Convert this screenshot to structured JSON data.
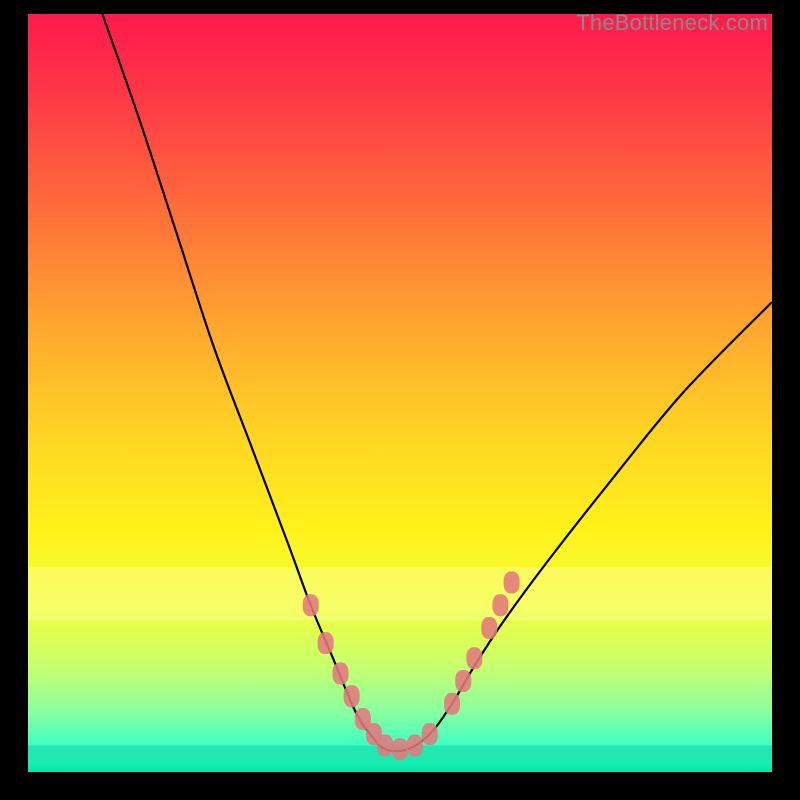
{
  "watermark": "TheBottleneck.com",
  "chart_data": {
    "type": "line",
    "title": "",
    "xlabel": "",
    "ylabel": "",
    "xlim": [
      0,
      100
    ],
    "ylim": [
      0,
      100
    ],
    "grid": false,
    "curve": {
      "description": "V-shaped bottleneck curve drawn on a vertical red-to-green gradient field. Curve plunges from upper-left border down to a flat minimum near x≈48 y≈3, rises to the right edge meeting the right border around y≈62.",
      "x": [
        10,
        15,
        20,
        25,
        30,
        35,
        38,
        41,
        44,
        46,
        48,
        51,
        54,
        57,
        60,
        64,
        70,
        78,
        88,
        100
      ],
      "y": [
        100,
        86,
        71,
        56,
        43,
        30,
        22,
        15,
        8,
        5,
        3,
        3,
        5,
        9,
        14,
        20,
        28,
        38,
        50,
        62
      ]
    },
    "markers": {
      "description": "Pale red rounded-rect markers clustered near the bottom of the V on both slopes.",
      "points": [
        {
          "x": 38,
          "y": 22
        },
        {
          "x": 40,
          "y": 17
        },
        {
          "x": 42,
          "y": 13
        },
        {
          "x": 43.5,
          "y": 10
        },
        {
          "x": 45,
          "y": 7
        },
        {
          "x": 46.5,
          "y": 5
        },
        {
          "x": 48,
          "y": 3.5
        },
        {
          "x": 50,
          "y": 3
        },
        {
          "x": 52,
          "y": 3.5
        },
        {
          "x": 54,
          "y": 5
        },
        {
          "x": 57,
          "y": 9
        },
        {
          "x": 58.5,
          "y": 12
        },
        {
          "x": 60,
          "y": 15
        },
        {
          "x": 62,
          "y": 19
        },
        {
          "x": 63.5,
          "y": 22
        },
        {
          "x": 65,
          "y": 25
        }
      ]
    },
    "gradient_stops": [
      {
        "offset": 0.0,
        "color": "#ff1a4d"
      },
      {
        "offset": 0.1,
        "color": "#ff3547"
      },
      {
        "offset": 0.25,
        "color": "#ff6a3a"
      },
      {
        "offset": 0.4,
        "color": "#ffa230"
      },
      {
        "offset": 0.55,
        "color": "#ffd324"
      },
      {
        "offset": 0.68,
        "color": "#fff21a"
      },
      {
        "offset": 0.78,
        "color": "#f3ff3a"
      },
      {
        "offset": 0.86,
        "color": "#c8ff6e"
      },
      {
        "offset": 0.92,
        "color": "#8affa0"
      },
      {
        "offset": 0.965,
        "color": "#3effc2"
      },
      {
        "offset": 1.0,
        "color": "#00e7a8"
      }
    ],
    "bands": [
      {
        "y0": 0.73,
        "y1": 0.8,
        "color": "rgba(255,255,180,0.35)"
      },
      {
        "y0": 0.965,
        "y1": 0.985,
        "color": "#20e8b0"
      }
    ]
  }
}
